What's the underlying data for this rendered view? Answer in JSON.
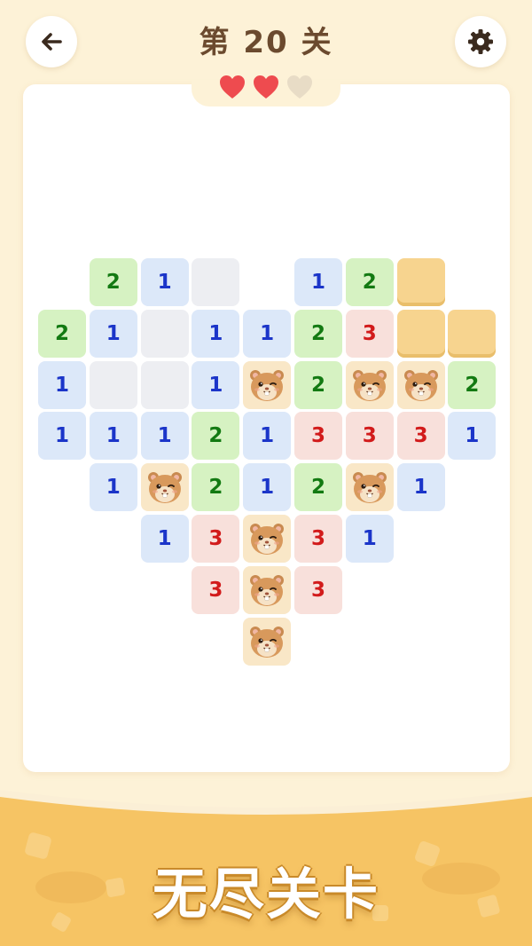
{
  "header": {
    "title": "第 20 关",
    "back_icon": "arrow-left-icon",
    "settings_icon": "gear-icon"
  },
  "lives": {
    "total": 3,
    "remaining": 2,
    "full_color": "#EE4B4F",
    "empty_color": "#E8DCC6"
  },
  "board": {
    "cols": 9,
    "rows": 8,
    "grid": [
      [
        null,
        "2",
        "1",
        "E",
        null,
        "1",
        "2",
        "C",
        null
      ],
      [
        "2",
        "1",
        "E",
        "1",
        "1",
        "2",
        "3",
        "C",
        "C"
      ],
      [
        "1",
        "E",
        "E",
        "1",
        "H",
        "2",
        "H",
        "H",
        "2"
      ],
      [
        "1",
        "1",
        "1",
        "2",
        "1",
        "3",
        "3",
        "3",
        "1"
      ],
      [
        null,
        "1",
        "H",
        "2",
        "1",
        "2",
        "H",
        "1",
        null
      ],
      [
        null,
        null,
        "1",
        "3",
        "H",
        "3",
        "1",
        null,
        null
      ],
      [
        null,
        null,
        null,
        "3",
        "H",
        "3",
        null,
        null,
        null
      ],
      [
        null,
        null,
        null,
        null,
        "H",
        null,
        null,
        null,
        null
      ]
    ],
    "legend": {
      "E": "revealed-empty",
      "C": "unrevealed",
      "H": "hamster"
    }
  },
  "footer": {
    "banner": "无尽关卡"
  },
  "colors": {
    "background": "#FDF2D7",
    "one": "#1B35C9",
    "two": "#137A12",
    "three": "#D21B1B",
    "banner_gold": "#F7C76A"
  }
}
